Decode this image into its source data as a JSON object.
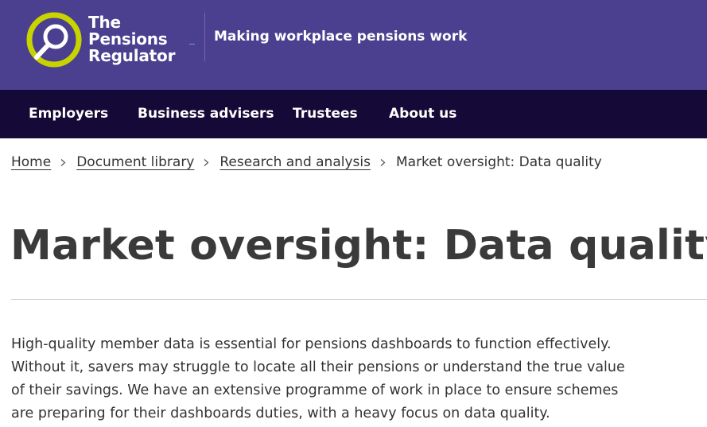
{
  "header": {
    "logo": {
      "line1": "The",
      "line2": "Pensions",
      "line3": "Regulator"
    },
    "tagline": "Making workplace pensions work",
    "colors": {
      "header_bg": "#4b3f8f",
      "logo_ring": "#c8d400",
      "nav_bg": "#150a37"
    }
  },
  "nav": {
    "items": [
      {
        "label": "Employers"
      },
      {
        "label": "Business advisers"
      },
      {
        "label": "Trustees"
      },
      {
        "label": "About us"
      }
    ]
  },
  "breadcrumb": {
    "items": [
      {
        "label": "Home"
      },
      {
        "label": "Document library"
      },
      {
        "label": "Research and analysis"
      }
    ],
    "current": "Market oversight: Data quality",
    "separator_icon": "chevron-right-icon"
  },
  "main": {
    "title": "Market oversight: Data quality",
    "intro": "High-quality member data is essential for pensions dashboards to function effectively. Without it, savers may struggle to locate all their pensions or understand the true value of their savings. We have an extensive programme of work in place to ensure schemes are preparing for their dashboards duties, with a heavy focus on data quality."
  }
}
